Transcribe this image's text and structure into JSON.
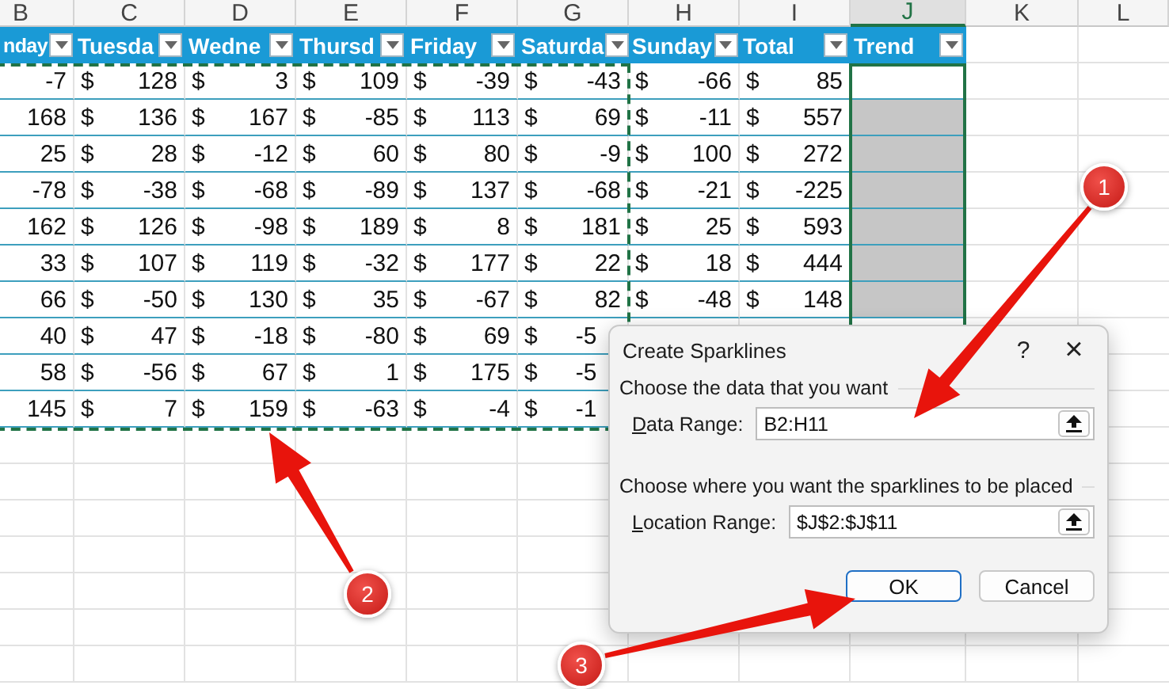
{
  "column_letters": [
    {
      "letter": "B",
      "selected": false
    },
    {
      "letter": "C",
      "selected": false
    },
    {
      "letter": "D",
      "selected": false
    },
    {
      "letter": "E",
      "selected": false
    },
    {
      "letter": "F",
      "selected": false
    },
    {
      "letter": "G",
      "selected": false
    },
    {
      "letter": "H",
      "selected": false
    },
    {
      "letter": "I",
      "selected": false
    },
    {
      "letter": "J",
      "selected": true
    },
    {
      "letter": "K",
      "selected": false
    },
    {
      "letter": "L",
      "selected": false
    }
  ],
  "table": {
    "headers": [
      "nday",
      "Tuesda",
      "Wedne",
      "Thursd",
      "Friday",
      "Saturda",
      "Sunday",
      "Total",
      "Trend"
    ],
    "rows": [
      {
        "cells": [
          {
            "amount": "-7"
          },
          {
            "symbol": "$",
            "amount": "128"
          },
          {
            "symbol": "$",
            "amount": "3"
          },
          {
            "symbol": "$",
            "amount": "109"
          },
          {
            "symbol": "$",
            "amount": "-39"
          },
          {
            "symbol": "$",
            "amount": "-43"
          },
          {
            "symbol": "$",
            "amount": "-66"
          },
          {
            "symbol": "$",
            "amount": "85"
          }
        ],
        "trend": {
          "active": true
        }
      },
      {
        "cells": [
          {
            "amount": "168"
          },
          {
            "symbol": "$",
            "amount": "136"
          },
          {
            "symbol": "$",
            "amount": "167"
          },
          {
            "symbol": "$",
            "amount": "-85"
          },
          {
            "symbol": "$",
            "amount": "113"
          },
          {
            "symbol": "$",
            "amount": "69"
          },
          {
            "symbol": "$",
            "amount": "-11"
          },
          {
            "symbol": "$",
            "amount": "557"
          }
        ],
        "trend": {
          "active": false
        }
      },
      {
        "cells": [
          {
            "amount": "25"
          },
          {
            "symbol": "$",
            "amount": "28"
          },
          {
            "symbol": "$",
            "amount": "-12"
          },
          {
            "symbol": "$",
            "amount": "60"
          },
          {
            "symbol": "$",
            "amount": "80"
          },
          {
            "symbol": "$",
            "amount": "-9"
          },
          {
            "symbol": "$",
            "amount": "100"
          },
          {
            "symbol": "$",
            "amount": "272"
          }
        ],
        "trend": {
          "active": false
        }
      },
      {
        "cells": [
          {
            "amount": "-78"
          },
          {
            "symbol": "$",
            "amount": "-38"
          },
          {
            "symbol": "$",
            "amount": "-68"
          },
          {
            "symbol": "$",
            "amount": "-89"
          },
          {
            "symbol": "$",
            "amount": "137"
          },
          {
            "symbol": "$",
            "amount": "-68"
          },
          {
            "symbol": "$",
            "amount": "-21"
          },
          {
            "symbol": "$",
            "amount": "-225"
          }
        ],
        "trend": {
          "active": false
        }
      },
      {
        "cells": [
          {
            "amount": "162"
          },
          {
            "symbol": "$",
            "amount": "126"
          },
          {
            "symbol": "$",
            "amount": "-98"
          },
          {
            "symbol": "$",
            "amount": "189"
          },
          {
            "symbol": "$",
            "amount": "8"
          },
          {
            "symbol": "$",
            "amount": "181"
          },
          {
            "symbol": "$",
            "amount": "25"
          },
          {
            "symbol": "$",
            "amount": "593"
          }
        ],
        "trend": {
          "active": false
        }
      },
      {
        "cells": [
          {
            "amount": "33"
          },
          {
            "symbol": "$",
            "amount": "107"
          },
          {
            "symbol": "$",
            "amount": "119"
          },
          {
            "symbol": "$",
            "amount": "-32"
          },
          {
            "symbol": "$",
            "amount": "177"
          },
          {
            "symbol": "$",
            "amount": "22"
          },
          {
            "symbol": "$",
            "amount": "18"
          },
          {
            "symbol": "$",
            "amount": "444"
          }
        ],
        "trend": {
          "active": false
        }
      },
      {
        "cells": [
          {
            "amount": "66"
          },
          {
            "symbol": "$",
            "amount": "-50"
          },
          {
            "symbol": "$",
            "amount": "130"
          },
          {
            "symbol": "$",
            "amount": "35"
          },
          {
            "symbol": "$",
            "amount": "-67"
          },
          {
            "symbol": "$",
            "amount": "82"
          },
          {
            "symbol": "$",
            "amount": "-48"
          },
          {
            "symbol": "$",
            "amount": "148"
          }
        ],
        "trend": {
          "active": false
        }
      },
      {
        "cells": [
          {
            "amount": "40"
          },
          {
            "symbol": "$",
            "amount": "47"
          },
          {
            "symbol": "$",
            "amount": "-18"
          },
          {
            "symbol": "$",
            "amount": "-80"
          },
          {
            "symbol": "$",
            "amount": "69"
          },
          {
            "symbol": "$",
            "amount": "-5"
          }
        ]
      },
      {
        "cells": [
          {
            "amount": "58"
          },
          {
            "symbol": "$",
            "amount": "-56"
          },
          {
            "symbol": "$",
            "amount": "67"
          },
          {
            "symbol": "$",
            "amount": "1"
          },
          {
            "symbol": "$",
            "amount": "175"
          },
          {
            "symbol": "$",
            "amount": "-5"
          }
        ]
      },
      {
        "cells": [
          {
            "amount": "145"
          },
          {
            "symbol": "$",
            "amount": "7"
          },
          {
            "symbol": "$",
            "amount": "159"
          },
          {
            "symbol": "$",
            "amount": "-63"
          },
          {
            "symbol": "$",
            "amount": "-4"
          },
          {
            "symbol": "$",
            "amount": "-1"
          }
        ]
      }
    ]
  },
  "dialog": {
    "title": "Create Sparklines",
    "help": "?",
    "close": "×",
    "sections": [
      {
        "heading": "Choose the data that you want",
        "label": "Data Range:",
        "value": "B2:H11"
      },
      {
        "heading": "Choose where you want the sparklines to be placed",
        "label": "Location Range:",
        "value": "$J$2:$J$11"
      }
    ],
    "buttons": [
      {
        "label": "OK",
        "selected": true
      },
      {
        "label": "Cancel",
        "selected": false
      }
    ]
  },
  "annotations": [
    {
      "label": "1"
    },
    {
      "label": "2"
    },
    {
      "label": "3"
    }
  ]
}
